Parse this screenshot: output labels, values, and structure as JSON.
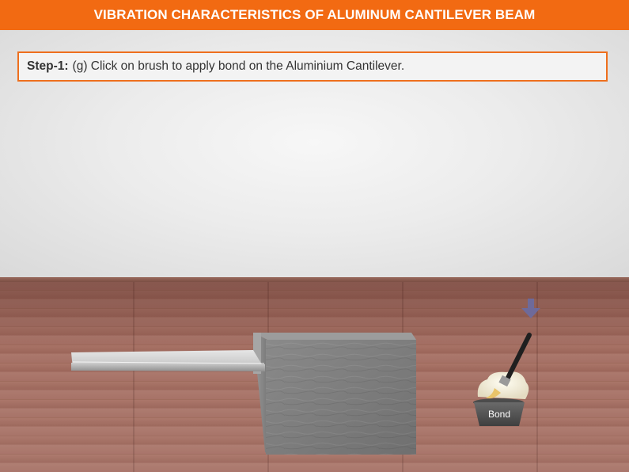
{
  "header": {
    "title": "VIBRATION CHARACTERISTICS OF ALUMINUM CANTILEVER BEAM"
  },
  "instruction": {
    "step_label": "Step-1:",
    "text": "(g) Click on brush to apply bond on the Aluminium Cantilever."
  },
  "bond": {
    "label": "Bond"
  },
  "colors": {
    "header": "#f26a12",
    "instruction_border": "#ee6f1d",
    "arrow": "#6e6a9a"
  },
  "icons": {
    "hint": "down-arrow-icon",
    "tool": "brush-icon"
  }
}
